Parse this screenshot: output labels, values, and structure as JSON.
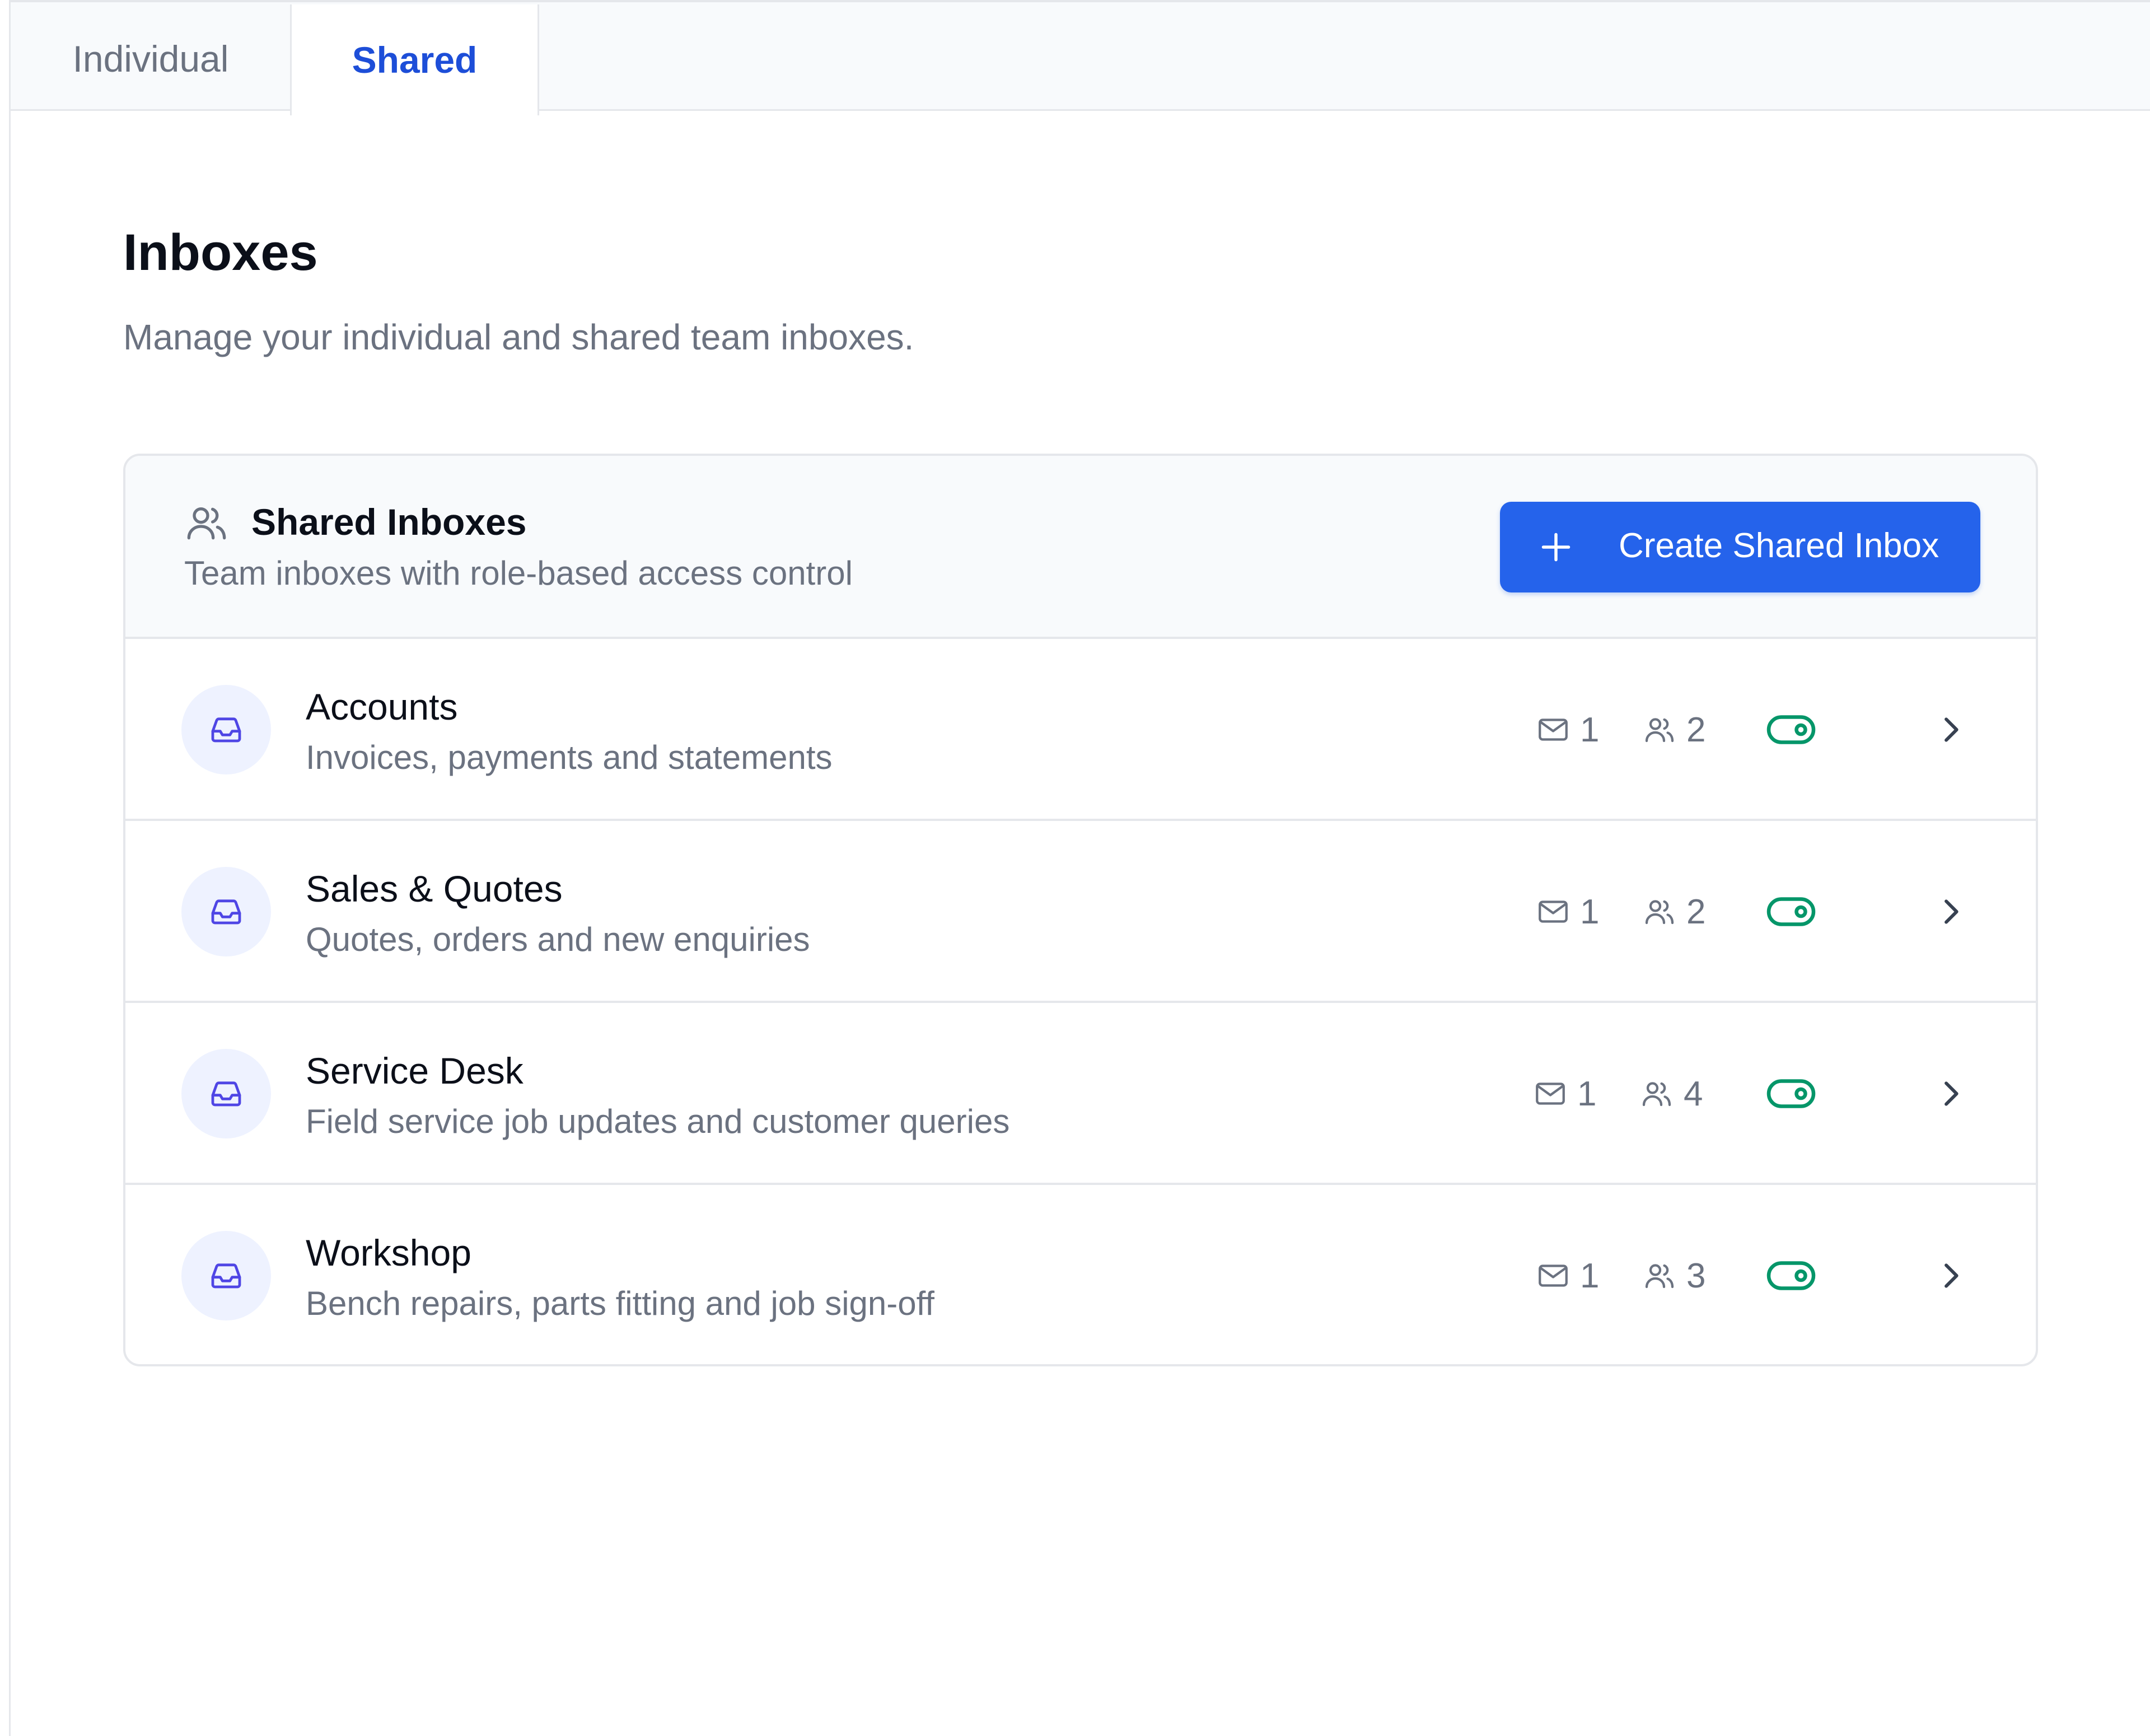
{
  "tabs": [
    {
      "label": "Individual",
      "active": false
    },
    {
      "label": "Shared",
      "active": true
    }
  ],
  "header": {
    "title": "Inboxes",
    "subtitle": "Manage your individual and shared team inboxes."
  },
  "card": {
    "icon": "users-icon",
    "title": "Shared Inboxes",
    "subtitle": "Team inboxes with role-based access control",
    "create_button": {
      "icon": "plus-icon",
      "label": "Create Shared Inbox"
    }
  },
  "inboxes": [
    {
      "name": "Accounts",
      "description": "Invoices, payments and statements",
      "mail_count": "1",
      "member_count": "2",
      "enabled": true
    },
    {
      "name": "Sales & Quotes",
      "description": "Quotes, orders and new enquiries",
      "mail_count": "1",
      "member_count": "2",
      "enabled": true
    },
    {
      "name": "Service Desk",
      "description": "Field service job updates and customer queries",
      "mail_count": "1",
      "member_count": "4",
      "enabled": true
    },
    {
      "name": "Workshop",
      "description": "Bench repairs, parts fitting and job sign-off",
      "mail_count": "1",
      "member_count": "3",
      "enabled": true
    }
  ],
  "colors": {
    "accent": "#2563eb",
    "active_tab_text": "#1d4ed8",
    "toggle_on": "#059669",
    "inbox_icon": "#4f46e5",
    "avatar_bg": "#eef2ff"
  }
}
